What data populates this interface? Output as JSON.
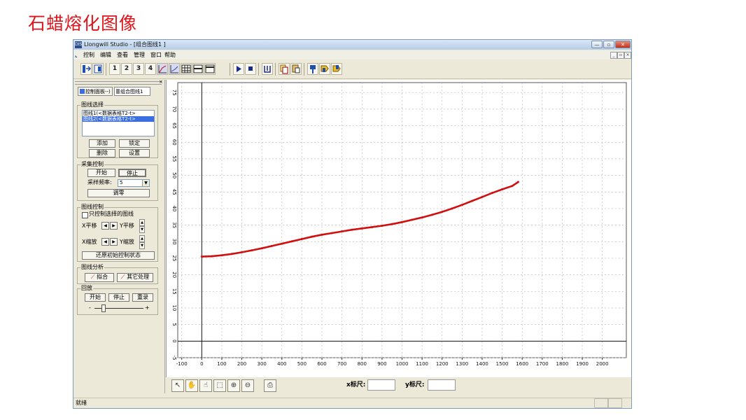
{
  "slide": {
    "title": "石蜡熔化图像"
  },
  "window": {
    "title": "Llongwill Studio - [组合图线1 ]",
    "icon_text": "DIS",
    "controls": {
      "minimize": "—",
      "restore": "▫",
      "close": "✕"
    },
    "mdi_controls": {
      "minimize": "_",
      "restore": "▫",
      "close": "×"
    }
  },
  "menu": {
    "items": [
      "控制",
      "编辑",
      "查看",
      "管理",
      "窗口",
      "帮助"
    ]
  },
  "toolbar": {
    "buttons": [
      "1",
      "2",
      "3",
      "4"
    ],
    "icons": [
      "pause-icon",
      "stop-icon",
      "play-icon",
      "stop-square-icon"
    ]
  },
  "panel": {
    "close_glyph": "×",
    "tabs": [
      "控制面板--)",
      "组合图线1"
    ],
    "curve_select": {
      "title": "图线选择",
      "items": [
        "图线1(<数据表格T2-t>",
        "图线2(<数据表格T2-t>"
      ],
      "selected_index": 1,
      "add": "添加",
      "lock": "锁定",
      "delete": "删除",
      "settings": "设置"
    },
    "acquisition": {
      "title": "采集控制",
      "start": "开始",
      "stop": "停止",
      "rate_label": "采样频率:",
      "rate_value": "5",
      "zero": "调零"
    },
    "graph_control": {
      "title": "图线控制",
      "only_selected": "只控制选择的图线",
      "x_pan": "X平移",
      "y_pan": "Y平移",
      "x_zoom": "X缩放",
      "y_zoom": "Y缩放",
      "reset": "还原初始控制状态"
    },
    "analysis": {
      "title": "图线分析",
      "fit": "拟合",
      "other": "其它处理"
    },
    "playback": {
      "title": "回放",
      "start": "开始",
      "stop": "停止",
      "replay": "重录",
      "minus": "-",
      "plus": "+"
    }
  },
  "bottom": {
    "x_scale_label": "x标尺:",
    "y_scale_label": "y标尺:",
    "x_scale_value": "",
    "y_scale_value": ""
  },
  "status": {
    "text": "就绪"
  },
  "colors": {
    "curve": "#d01010",
    "title": "#e0141b",
    "grid": "#bbbbbb"
  },
  "chart_data": {
    "type": "line",
    "title": "",
    "xlabel": "",
    "ylabel": "",
    "xlim": [
      -120,
      2120
    ],
    "ylim": [
      -5,
      78
    ],
    "grid": true,
    "x_ticks": [
      -100,
      0,
      100,
      200,
      300,
      400,
      500,
      600,
      700,
      800,
      900,
      1000,
      1100,
      1200,
      1300,
      1400,
      1500,
      1600,
      1700,
      1800,
      1900,
      2000
    ],
    "y_ticks": [
      -5,
      0,
      5,
      10,
      15,
      20,
      25,
      30,
      35,
      40,
      45,
      50,
      55,
      60,
      65,
      70,
      75
    ],
    "series": [
      {
        "x": [
          0,
          50,
          100,
          150,
          200,
          250,
          300,
          350,
          400,
          450,
          500,
          550,
          600,
          650,
          700,
          750,
          800,
          850,
          900,
          950,
          1000,
          1050,
          1100,
          1150,
          1200,
          1250,
          1300,
          1350,
          1400,
          1450,
          1500,
          1550,
          1580
        ],
        "y": [
          25.5,
          25.6,
          25.9,
          26.3,
          26.8,
          27.4,
          28.0,
          28.7,
          29.4,
          30.1,
          30.8,
          31.5,
          32.1,
          32.6,
          33.1,
          33.6,
          34.0,
          34.4,
          34.8,
          35.3,
          35.9,
          36.6,
          37.3,
          38.1,
          39.0,
          40.0,
          41.1,
          42.3,
          43.5,
          44.7,
          45.8,
          46.8,
          48.0
        ]
      }
    ]
  }
}
